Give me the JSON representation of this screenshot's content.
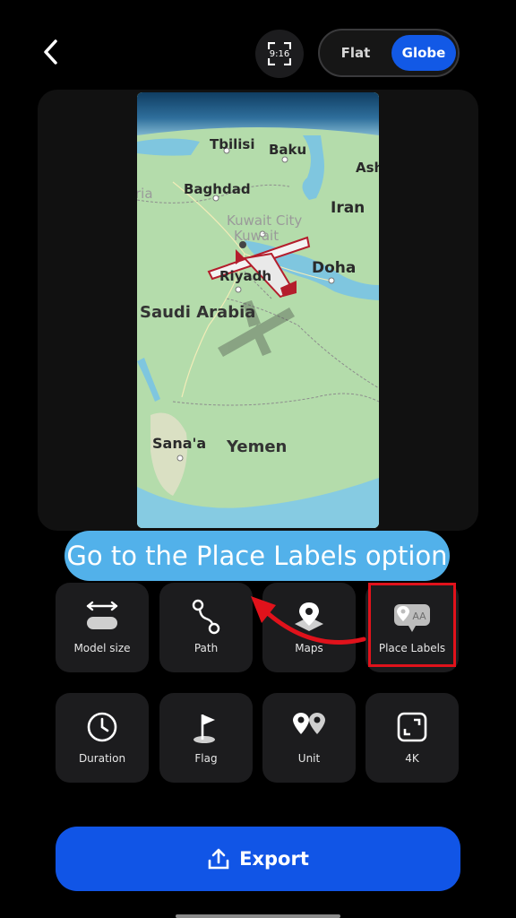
{
  "header": {
    "ratio_label": "9:16",
    "view_toggle": {
      "flat": "Flat",
      "globe": "Globe",
      "selected": "Globe"
    }
  },
  "map": {
    "cities": [
      "Tbilisi",
      "Baku",
      "Ash",
      "Baghdad",
      "Iran",
      "Kuwait City",
      "Kuwait",
      "Doha",
      "Riyadh",
      "Sana'a"
    ],
    "countries": [
      "Saudi Arabia",
      "Yemen"
    ],
    "partial": "ria"
  },
  "banner": {
    "text": "Go to the Place Labels option"
  },
  "tools": [
    {
      "label": "Model size",
      "icon": "resize-icon"
    },
    {
      "label": "Path",
      "icon": "path-icon"
    },
    {
      "label": "Maps",
      "icon": "map-pin-icon"
    },
    {
      "label": "Place Labels",
      "icon": "place-labels-icon"
    },
    {
      "label": "Duration",
      "icon": "clock-icon"
    },
    {
      "label": "Flag",
      "icon": "flag-icon"
    },
    {
      "label": "Unit",
      "icon": "unit-pins-icon"
    },
    {
      "label": "4K",
      "icon": "expand-icon"
    }
  ],
  "export": {
    "label": "Export",
    "icon": "upload-icon"
  },
  "colors": {
    "accent": "#1259e6",
    "banner": "#52b1ea",
    "highlight": "#e0121b",
    "tile": "#1c1c1e"
  }
}
